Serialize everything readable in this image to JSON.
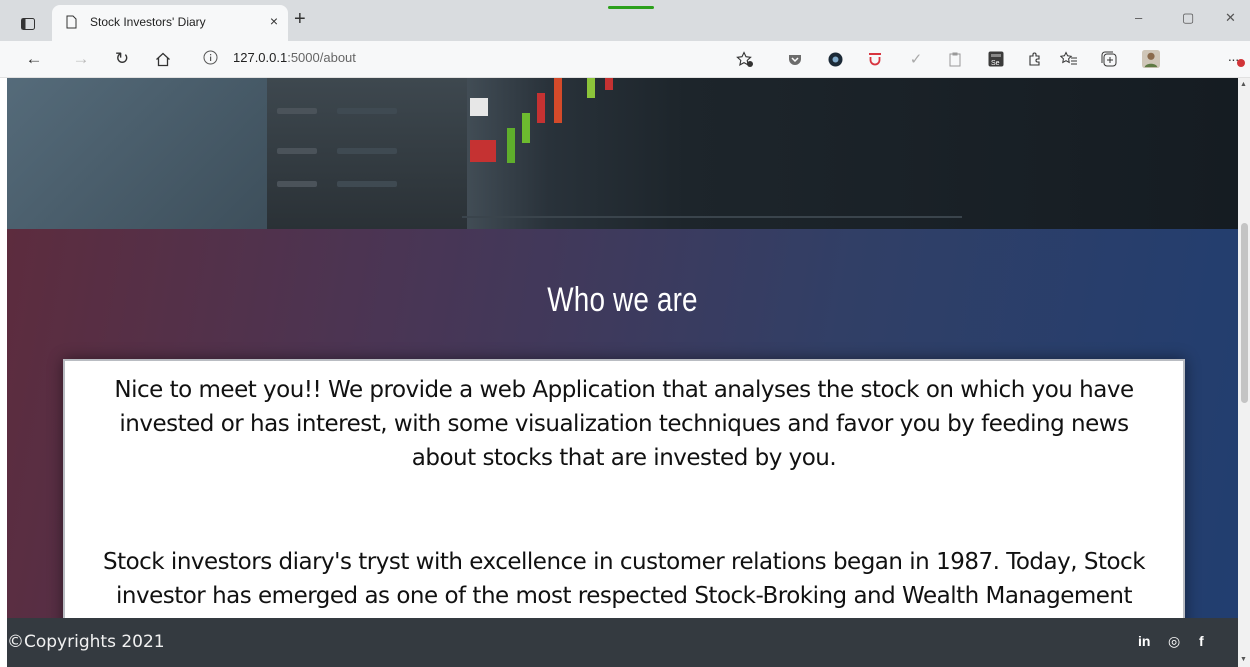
{
  "browser": {
    "tab_title": "Stock Investors' Diary",
    "tab_close": "×",
    "new_tab": "+",
    "url_host": "127.0.0.1",
    "url_path": ":5000/about",
    "window_controls": {
      "minimize": "–",
      "maximize": "▢",
      "close": "✕"
    }
  },
  "page": {
    "heading": "Who we are",
    "paragraph1": "Nice to meet you!! We provide a web Application that analyses the stock on which you have invested or has interest, with some visualization techniques and favor you by feeding news about stocks that are invested by you.",
    "paragraph2": "Stock investors diary's tryst with excellence in customer relations began in 1987. Today, Stock investor has emerged as one of the most respected Stock-Broking and Wealth Management"
  },
  "footer": {
    "copyright": "©Copyrights 2021",
    "social": {
      "linkedin": "in",
      "instagram": "◎",
      "facebook": "f"
    }
  },
  "colors": {
    "footer_bg": "#343a40",
    "section_gradient_start": "#5d2c3e",
    "section_gradient_end": "#213e70"
  }
}
